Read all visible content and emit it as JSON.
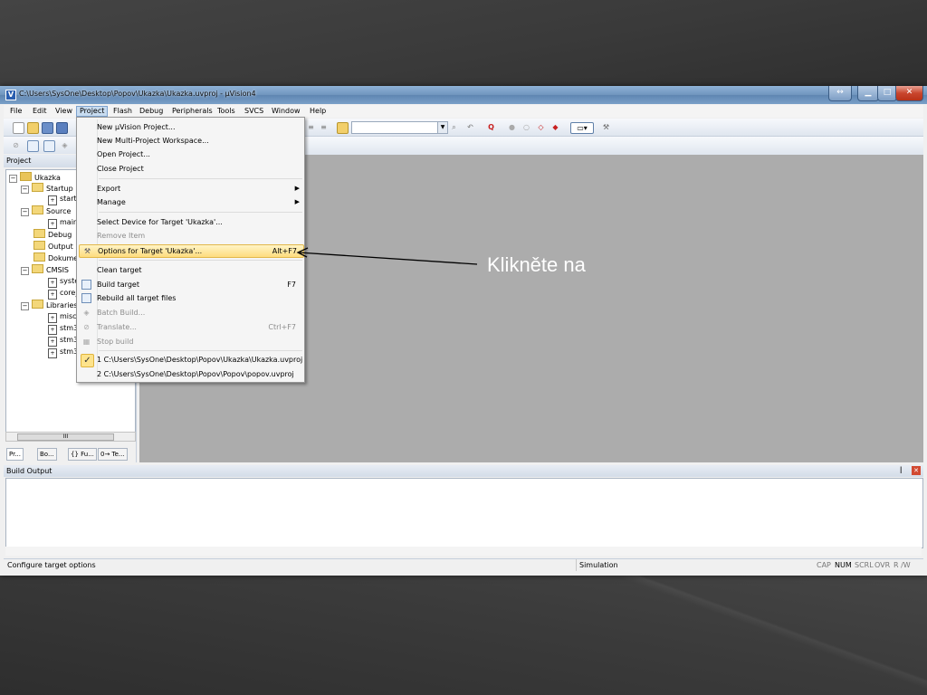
{
  "window": {
    "title": "C:\\Users\\SysOne\\Desktop\\Popov\\Ukazka\\Ukazka.uvproj - µVision4",
    "app_icon_label": "V",
    "buttons": {
      "restore": "↔",
      "minimize": "▁",
      "maximize": "□",
      "close": "✕"
    }
  },
  "menubar": {
    "items": [
      "File",
      "Edit",
      "View",
      "Project",
      "Flash",
      "Debug",
      "Peripherals",
      "Tools",
      "SVCS",
      "Window",
      "Help"
    ],
    "active": "Project"
  },
  "project_menu": {
    "items": [
      {
        "label": "New µVision Project...",
        "accel": "",
        "state": "enabled"
      },
      {
        "label": "New Multi-Project Workspace...",
        "accel": "",
        "state": "enabled"
      },
      {
        "label": "Open Project...",
        "accel": "",
        "state": "enabled"
      },
      {
        "label": "Close Project",
        "accel": "",
        "state": "enabled"
      },
      {
        "label": "Export",
        "accel": "",
        "state": "submenu"
      },
      {
        "label": "Manage",
        "accel": "",
        "state": "submenu"
      },
      {
        "label": "Select Device for Target 'Ukazka'...",
        "accel": "",
        "state": "enabled"
      },
      {
        "label": "Remove Item",
        "accel": "",
        "state": "disabled"
      },
      {
        "label": "Options for Target 'Ukazka'...",
        "accel": "Alt+F7",
        "state": "highlighted"
      },
      {
        "label": "Clean target",
        "accel": "",
        "state": "enabled"
      },
      {
        "label": "Build target",
        "accel": "F7",
        "state": "enabled"
      },
      {
        "label": "Rebuild all target files",
        "accel": "",
        "state": "enabled"
      },
      {
        "label": "Batch Build...",
        "accel": "",
        "state": "disabled"
      },
      {
        "label": "Translate...",
        "accel": "Ctrl+F7",
        "state": "disabled"
      },
      {
        "label": "Stop build",
        "accel": "",
        "state": "disabled"
      },
      {
        "label": "1 C:\\Users\\SysOne\\Desktop\\Popov\\Ukazka\\Ukazka.uvproj",
        "accel": "",
        "state": "checked"
      },
      {
        "label": "2 C:\\Users\\SysOne\\Desktop\\Popov\\Popov\\popov.uvproj",
        "accel": "",
        "state": "enabled"
      }
    ]
  },
  "project_panel": {
    "title": "Project",
    "tree": [
      {
        "label": "Ukazka",
        "kind": "root"
      },
      {
        "label": "Startup",
        "kind": "folder"
      },
      {
        "label": "startu",
        "kind": "file"
      },
      {
        "label": "Source",
        "kind": "folder"
      },
      {
        "label": "main",
        "kind": "file"
      },
      {
        "label": "Debug",
        "kind": "folder"
      },
      {
        "label": "Output",
        "kind": "folder"
      },
      {
        "label": "Dokume",
        "kind": "folder"
      },
      {
        "label": "CMSIS",
        "kind": "folder"
      },
      {
        "label": "syste",
        "kind": "file"
      },
      {
        "label": "core_",
        "kind": "file"
      },
      {
        "label": "Libraries",
        "kind": "folder"
      },
      {
        "label": "misc.",
        "kind": "file"
      },
      {
        "label": "stm3",
        "kind": "file"
      },
      {
        "label": "stm3",
        "kind": "file"
      },
      {
        "label": "stm3",
        "kind": "file"
      }
    ],
    "scroll_thumb": "III",
    "tabs": [
      "Pr...",
      "Bo...",
      "{} Fu...",
      "0→ Te..."
    ]
  },
  "build_output": {
    "title": "Build Output",
    "pin_icon": "ꟾ",
    "close_icon": "✕"
  },
  "statusbar": {
    "message": "Configure target options",
    "mode": "Simulation",
    "indicators": [
      "CAP",
      "NUM",
      "SCRL",
      "OVR",
      "R /W"
    ]
  },
  "callout": {
    "text": "Klikněte na"
  }
}
